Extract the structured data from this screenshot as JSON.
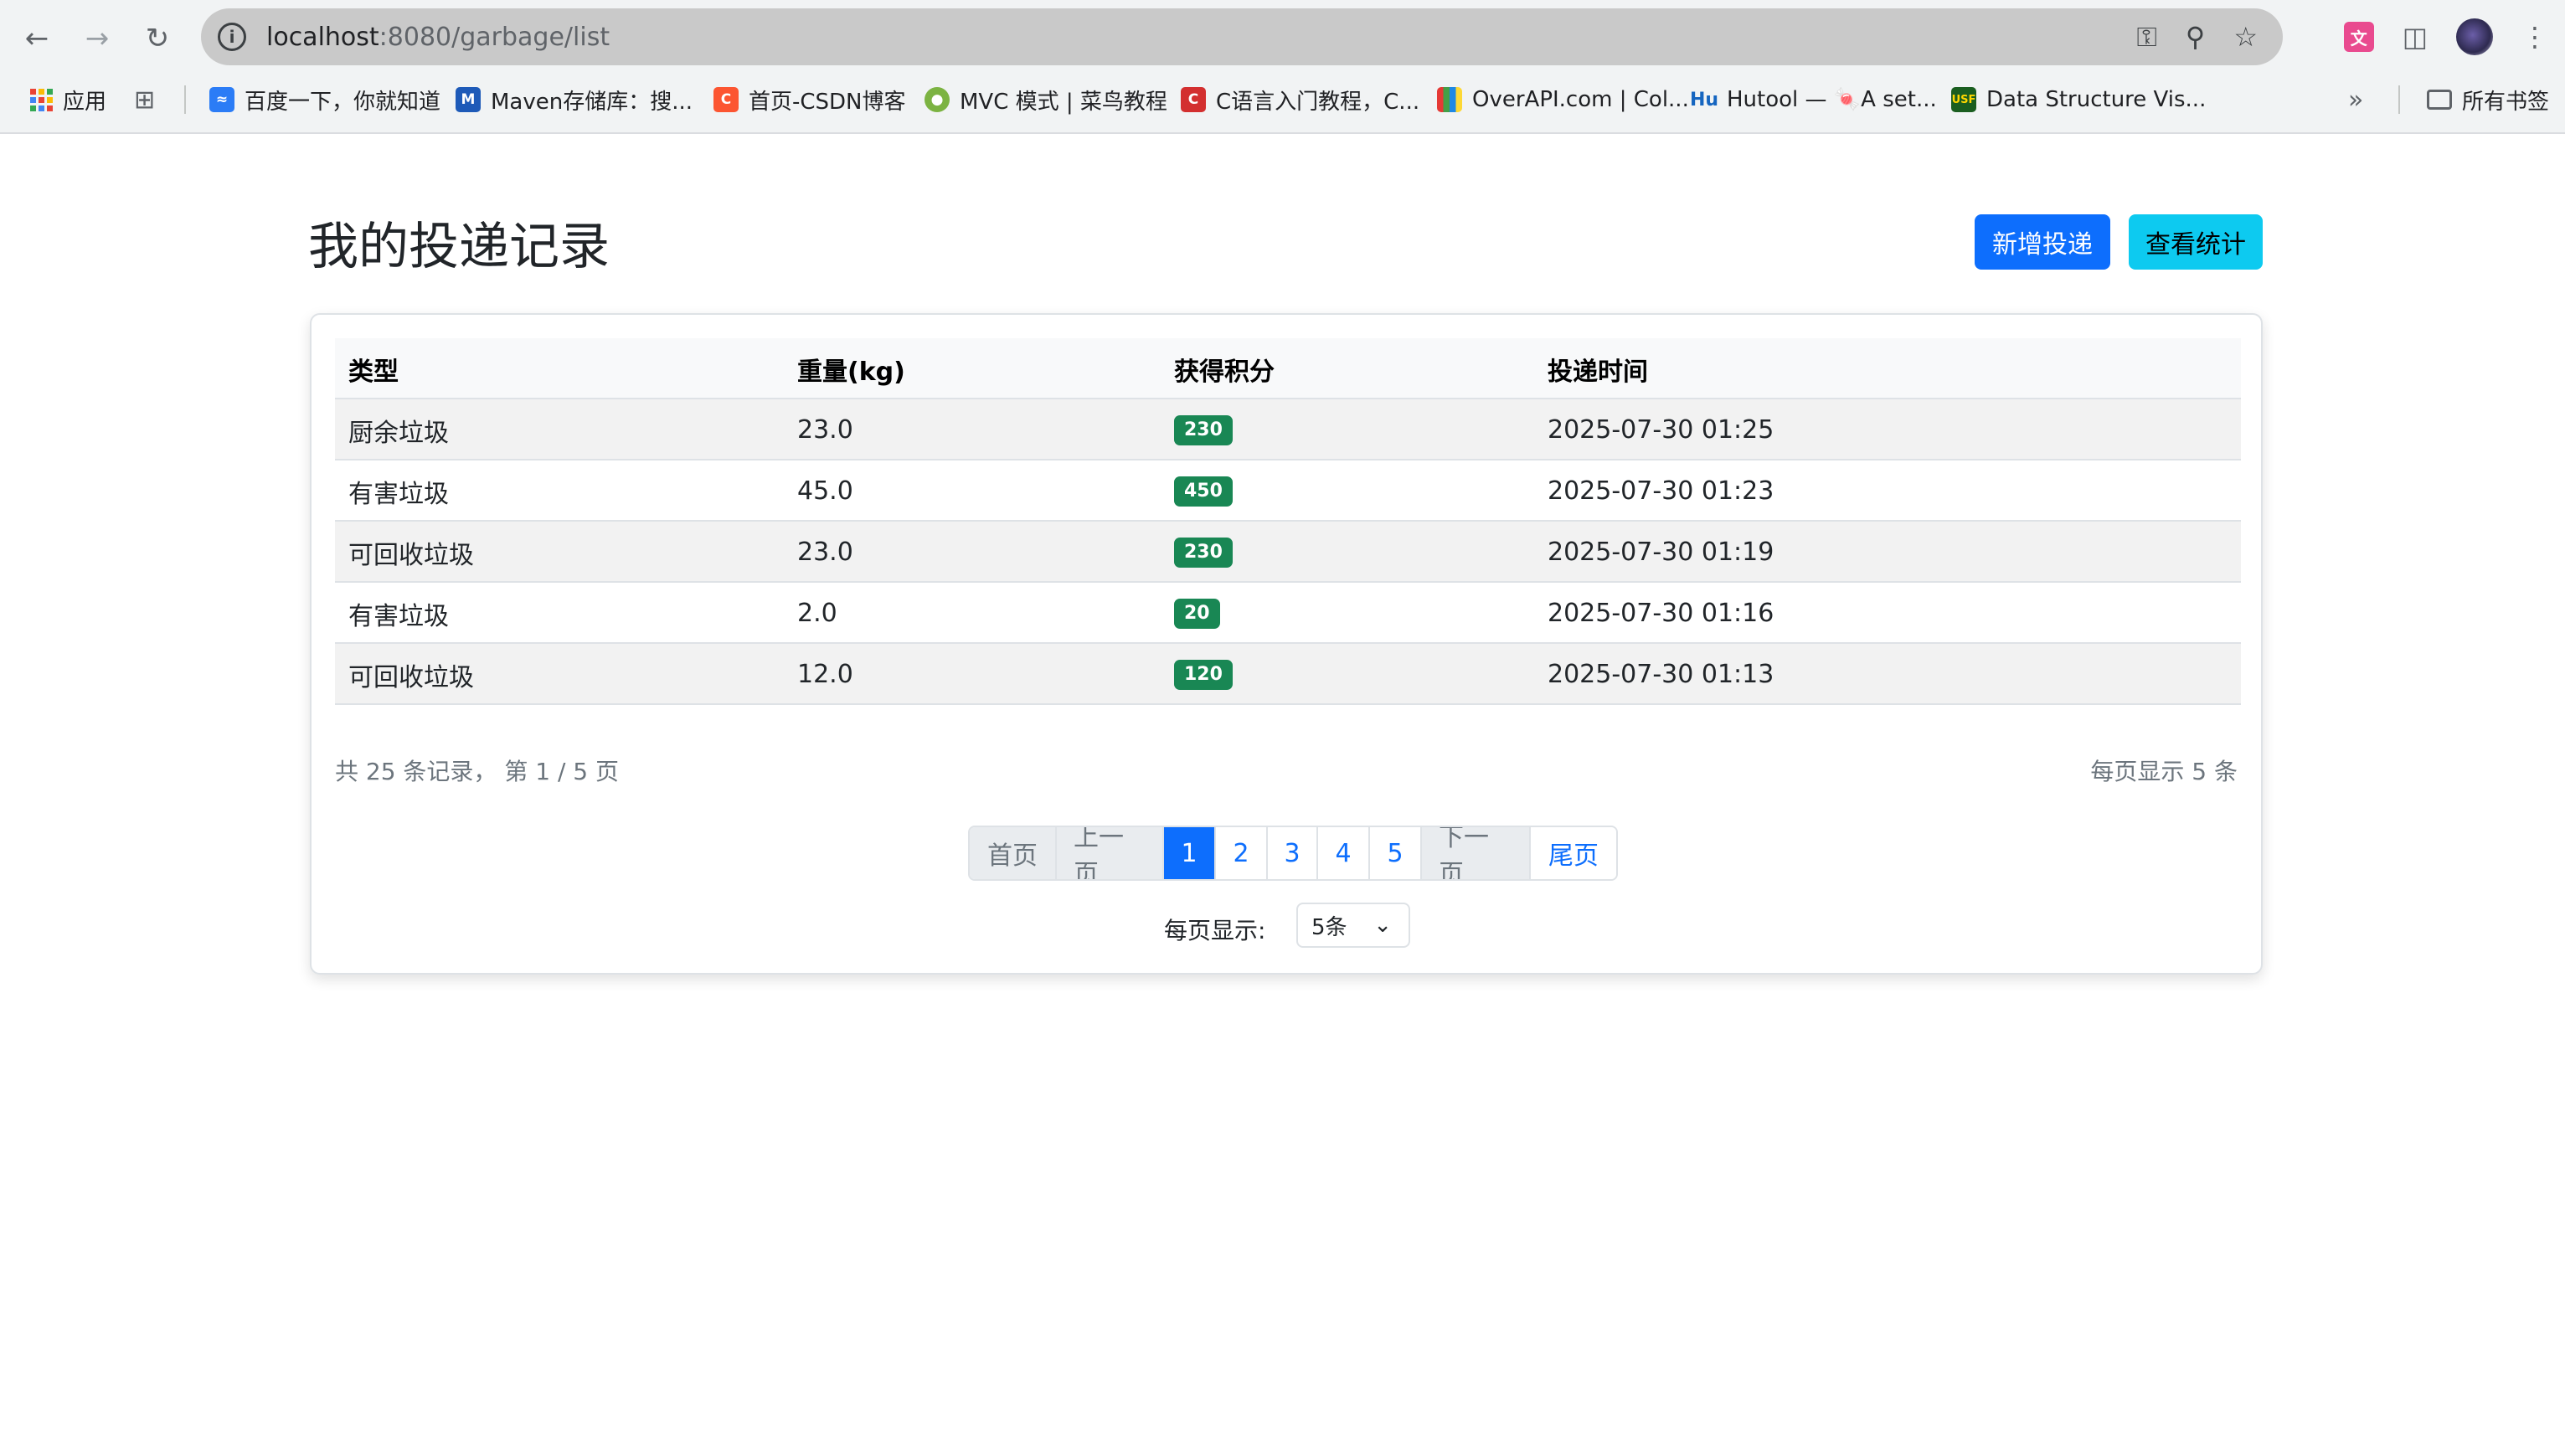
{
  "browser": {
    "url_host": "localhost",
    "url_rest": ":8080/garbage/list",
    "bookmarks": [
      {
        "label": "应用",
        "icon": "apps-grid-icon"
      },
      {
        "label": "",
        "icon": "tab-groups-icon"
      },
      {
        "label": "百度一下，你就知道",
        "icon": "baidu-icon"
      },
      {
        "label": "Maven存储库：搜...",
        "icon": "maven-icon",
        "glyph": "M"
      },
      {
        "label": "首页-CSDN博客",
        "icon": "csdn-icon",
        "glyph": "C"
      },
      {
        "label": "MVC 模式 | 菜鸟教程",
        "icon": "runoob-icon"
      },
      {
        "label": "C语言入门教程，C...",
        "icon": "c-lang-icon",
        "glyph": "C"
      },
      {
        "label": "OverAPI.com | Col...",
        "icon": "overapi-icon"
      },
      {
        "label": "Hutool — 🍬A set...",
        "icon": "hutool-icon",
        "glyph": "Hu"
      },
      {
        "label": "Data Structure Vis...",
        "icon": "usf-icon",
        "glyph": "USF"
      }
    ],
    "all_bookmarks_label": "所有书签"
  },
  "page": {
    "title": "我的投递记录",
    "add_button": "新增投递",
    "stats_button": "查看统计"
  },
  "table": {
    "headers": [
      "类型",
      "重量(kg)",
      "获得积分",
      "投递时间"
    ],
    "rows": [
      {
        "type": "厨余垃圾",
        "weight": "23.0",
        "points": "230",
        "time": "2025-07-30 01:25"
      },
      {
        "type": "有害垃圾",
        "weight": "45.0",
        "points": "450",
        "time": "2025-07-30 01:23"
      },
      {
        "type": "可回收垃圾",
        "weight": "23.0",
        "points": "230",
        "time": "2025-07-30 01:19"
      },
      {
        "type": "有害垃圾",
        "weight": "2.0",
        "points": "20",
        "time": "2025-07-30 01:16"
      },
      {
        "type": "可回收垃圾",
        "weight": "12.0",
        "points": "120",
        "time": "2025-07-30 01:13"
      }
    ]
  },
  "summary": {
    "text": "共 25 条记录， 第 1 / 5 页",
    "per_page_note": "每页显示 5 条"
  },
  "pager": {
    "first": "首页",
    "prev": "上一页",
    "pages": [
      "1",
      "2",
      "3",
      "4",
      "5"
    ],
    "current": "1",
    "next": "下一页",
    "last": "尾页"
  },
  "page_size": {
    "label": "每页显示:",
    "selected": "5条"
  },
  "colors": {
    "primary": "#0d6efd",
    "info": "#0dcaf0",
    "badge": "#198754"
  }
}
